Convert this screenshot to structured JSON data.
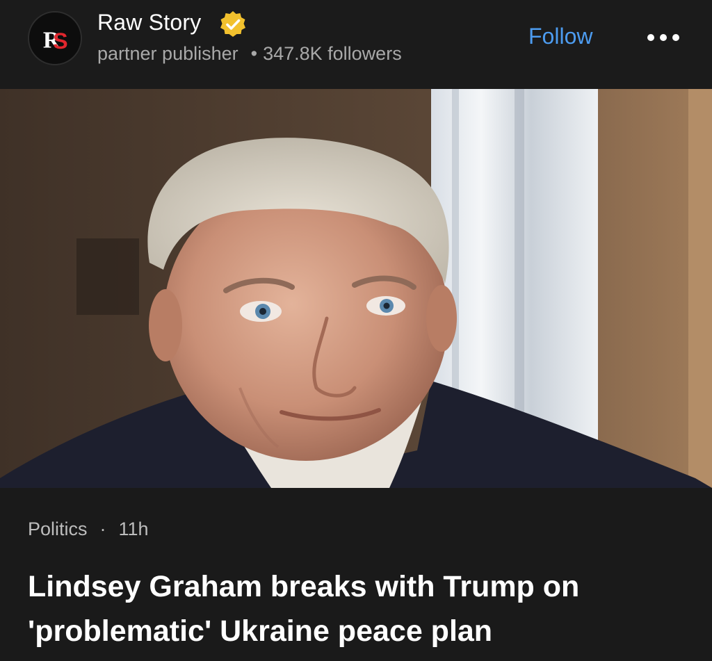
{
  "publisher": {
    "logo_text": "RS",
    "name": "Raw Story",
    "verified_icon": "verified-badge-icon",
    "type": "partner publisher",
    "followers": "347.8K followers",
    "follow_label": "Follow",
    "more_icon": "more-options-icon"
  },
  "article": {
    "category": "Politics",
    "separator": "·",
    "age": "11h",
    "headline": "Lindsey Graham breaks with Trump on 'problematic' Ukraine peace plan",
    "image_alt": "Portrait photo of a white-haired man in a dark suit"
  },
  "colors": {
    "background": "#1b1b1b",
    "follow_blue": "#4d9cf0",
    "verified_gold": "#f2c12e",
    "logo_red": "#e0262d"
  }
}
